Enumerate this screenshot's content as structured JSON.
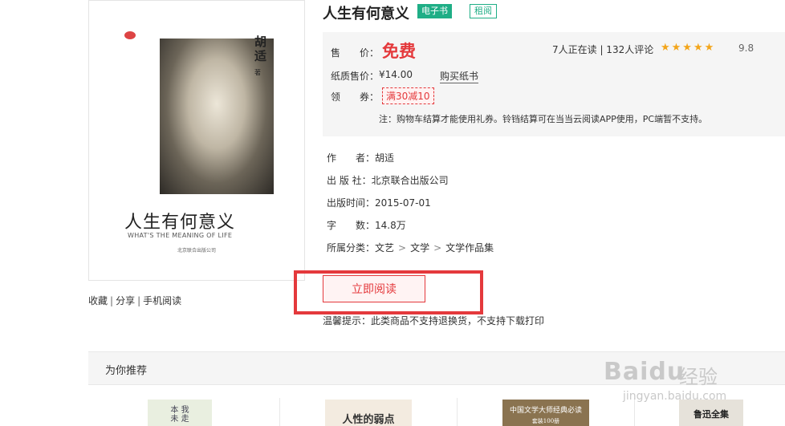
{
  "cover": {
    "author_vertical": "胡适",
    "author_suffix": "著",
    "title": "人生有何意义",
    "subtitle": "WHAT'S THE MEANING OF LIFE",
    "publisher_small": "北京联合出版公司"
  },
  "share": {
    "collect": "收藏",
    "sep": "|",
    "share": "分享",
    "mobile": "手机阅读"
  },
  "book": {
    "title": "人生有何意义",
    "tag_ebook": "电子书",
    "tag_rent": "租阅"
  },
  "price": {
    "label": "售　　价：",
    "value": "免费",
    "paper_label": "纸质售价：",
    "paper_value": "¥14.00",
    "buy_paper": "购买纸书",
    "coupon_label": "领　　券：",
    "coupon": "满30减10",
    "note": "注：购物车结算才能使用礼券。铃铛结算可在当当云阅读APP使用，PC端暂不支持。",
    "stats": "7人正在读 | 132人评论",
    "stars": "★★★★★",
    "score": "9.8"
  },
  "info": {
    "author": "作　　者：胡适",
    "publisher": "出 版 社：北京联合出版公司",
    "date": "出版时间：2015-07-01",
    "words": "字　　数：14.8万",
    "category_label": "所属分类：",
    "categories": [
      "文艺",
      "文学",
      "文学作品集"
    ],
    "cat_sep": ">"
  },
  "read_button": "立即阅读",
  "tip": "温馨提示：此类商品不支持退换货，不支持下载打印",
  "recommend": {
    "title": "为你推荐",
    "books": [
      {
        "cover_text": "本 我\n未 走"
      },
      {
        "cover_text": "人性的弱点"
      },
      {
        "cover_text": "中国文学大师经典必读",
        "cover_sub": "套装100册"
      },
      {
        "cover_text": "鲁迅全集"
      }
    ]
  },
  "watermark": {
    "logo": "Baidu",
    "cn": "经验",
    "url": "jingyan.baidu.com"
  },
  "colors": {
    "accent": "#e4393c",
    "green": "#1fae86",
    "star": "#f3a51a"
  }
}
